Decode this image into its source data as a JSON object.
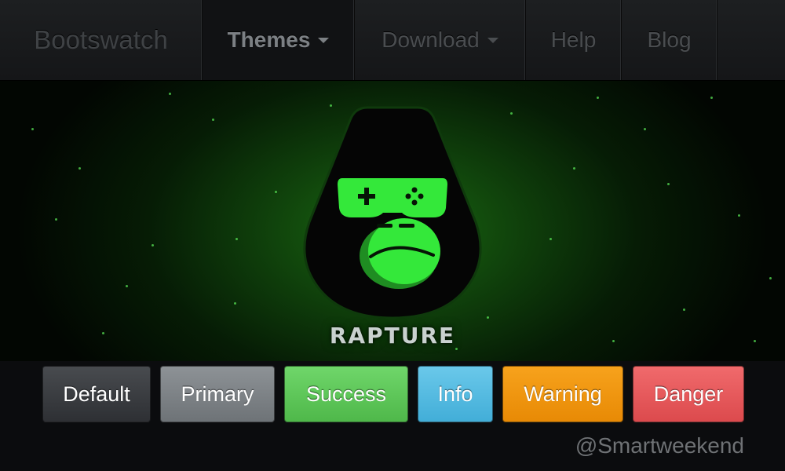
{
  "navbar": {
    "brand": "Bootswatch",
    "items": [
      {
        "label": "Themes",
        "dropdown": true,
        "active": true
      },
      {
        "label": "Download",
        "dropdown": true,
        "active": false
      },
      {
        "label": "Help",
        "dropdown": false,
        "active": false
      },
      {
        "label": "Blog",
        "dropdown": false,
        "active": false
      }
    ]
  },
  "hero": {
    "theme_name": "RAPTURE",
    "logo_icon": "gorilla-gamepad-icon",
    "accent_color": "#33e637"
  },
  "buttons": [
    {
      "label": "Default",
      "color": "#3a3d41"
    },
    {
      "label": "Primary",
      "color": "#7c8185"
    },
    {
      "label": "Success",
      "color": "#5cc957"
    },
    {
      "label": "Info",
      "color": "#55bce2"
    },
    {
      "label": "Warning",
      "color": "#f09612"
    },
    {
      "label": "Danger",
      "color": "#e85a5c"
    }
  ],
  "watermark": "@Smartweekend"
}
